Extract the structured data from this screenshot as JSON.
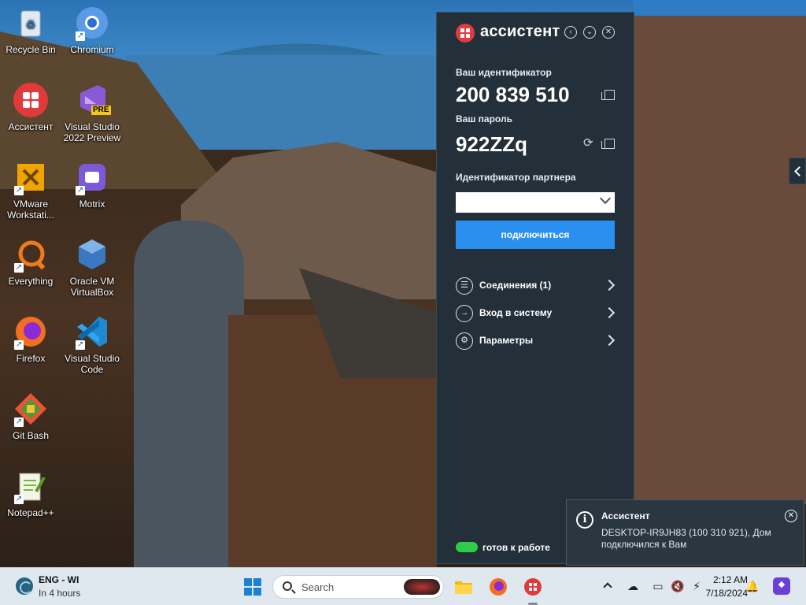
{
  "desktop": {
    "icons": [
      {
        "label": "Recycle Bin",
        "icon": "recycle-bin-icon"
      },
      {
        "label": "Chromium",
        "icon": "chromium-icon"
      },
      {
        "label": "Ассистент",
        "icon": "assistant-app-icon"
      },
      {
        "label": "Visual Studio 2022 Preview",
        "icon": "visual-studio-preview-icon"
      },
      {
        "label": "VMware Workstati...",
        "icon": "vmware-icon"
      },
      {
        "label": "Motrix",
        "icon": "motrix-icon"
      },
      {
        "label": "Everything",
        "icon": "everything-search-icon"
      },
      {
        "label": "Oracle VM VirtualBox",
        "icon": "virtualbox-icon"
      },
      {
        "label": "Firefox",
        "icon": "firefox-icon"
      },
      {
        "label": "Visual Studio Code",
        "icon": "vscode-icon"
      },
      {
        "label": "Git Bash",
        "icon": "git-bash-icon"
      },
      {
        "label": "Notepad++",
        "icon": "notepad-plus-plus-icon"
      }
    ],
    "vs_badge": "PRE"
  },
  "assistant": {
    "title": "ассистент",
    "id_label": "Ваш идентификатор",
    "id_value": "200 839 510",
    "password_label": "Ваш пароль",
    "password_value": "922ZZq",
    "partner_label": "Идентификатор партнера",
    "partner_value": "",
    "connect_label": "подключиться",
    "menu": [
      {
        "label": "Соединения (1)",
        "icon": "list-icon"
      },
      {
        "label": "Вход в систему",
        "icon": "login-icon"
      },
      {
        "label": "Параметры",
        "icon": "settings-icon"
      }
    ],
    "status_text": "готов к работе",
    "status_color": "#2ecc47",
    "accent_color": "#2b8ff0"
  },
  "notification": {
    "title": "Ассистент",
    "body": "DESKTOP-IR9JH83 (100 310 921), Дом подключился к Вам"
  },
  "taskbar": {
    "weather_title": "ENG - WI",
    "weather_sub": "In 4 hours",
    "search_placeholder": "Search",
    "clock_time": "2:12 AM",
    "clock_date": "7/18/2024"
  }
}
